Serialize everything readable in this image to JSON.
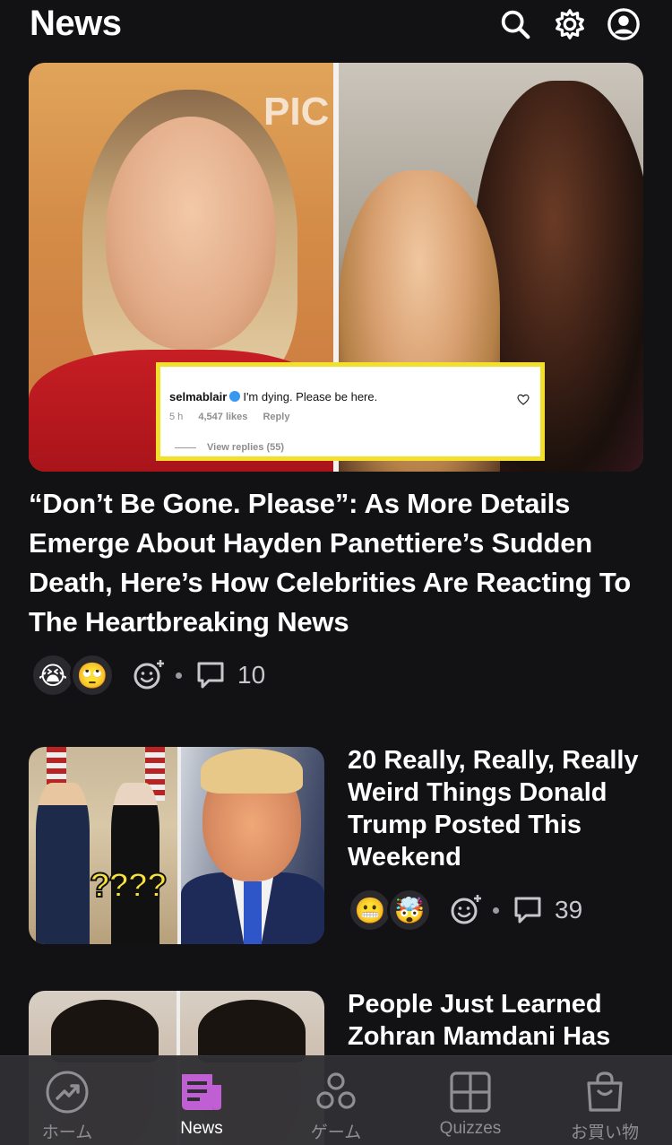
{
  "header": {
    "title": "News"
  },
  "hero": {
    "image_overlay_text": "PIC",
    "comment": {
      "username": "selmablair",
      "text": "I'm dying. Please be here.",
      "time": "5 h",
      "likes": "4,547 likes",
      "reply": "Reply",
      "view_replies": "View replies (55)"
    },
    "title": "“Don’t Be Gone. Please”: As More Details Emerge About Hayden Panettiere’s Sudden Death, Here’s How Celebrities Are Reacting To The Heartbreaking News",
    "reactions": [
      "😭",
      "🙄"
    ],
    "comment_count": "10"
  },
  "stories": [
    {
      "title": "20 Really, Really, Really Weird Things Donald Trump Posted This Weekend",
      "thumb_text": "????",
      "reactions": [
        "😬",
        "🤯"
      ],
      "comment_count": "39"
    },
    {
      "title": "People Just Learned Zohran Mamdani Has"
    }
  ],
  "tabbar": {
    "tabs": [
      {
        "label": "ホーム",
        "icon": "trending-icon",
        "active": false
      },
      {
        "label": "News",
        "icon": "news-icon",
        "active": true
      },
      {
        "label": "ゲーム",
        "icon": "games-icon",
        "active": false
      },
      {
        "label": "Quizzes",
        "icon": "quizzes-icon",
        "active": false
      },
      {
        "label": "お買い物",
        "icon": "shopping-bag-icon",
        "active": false
      }
    ],
    "active_color": "#c05fd4"
  }
}
